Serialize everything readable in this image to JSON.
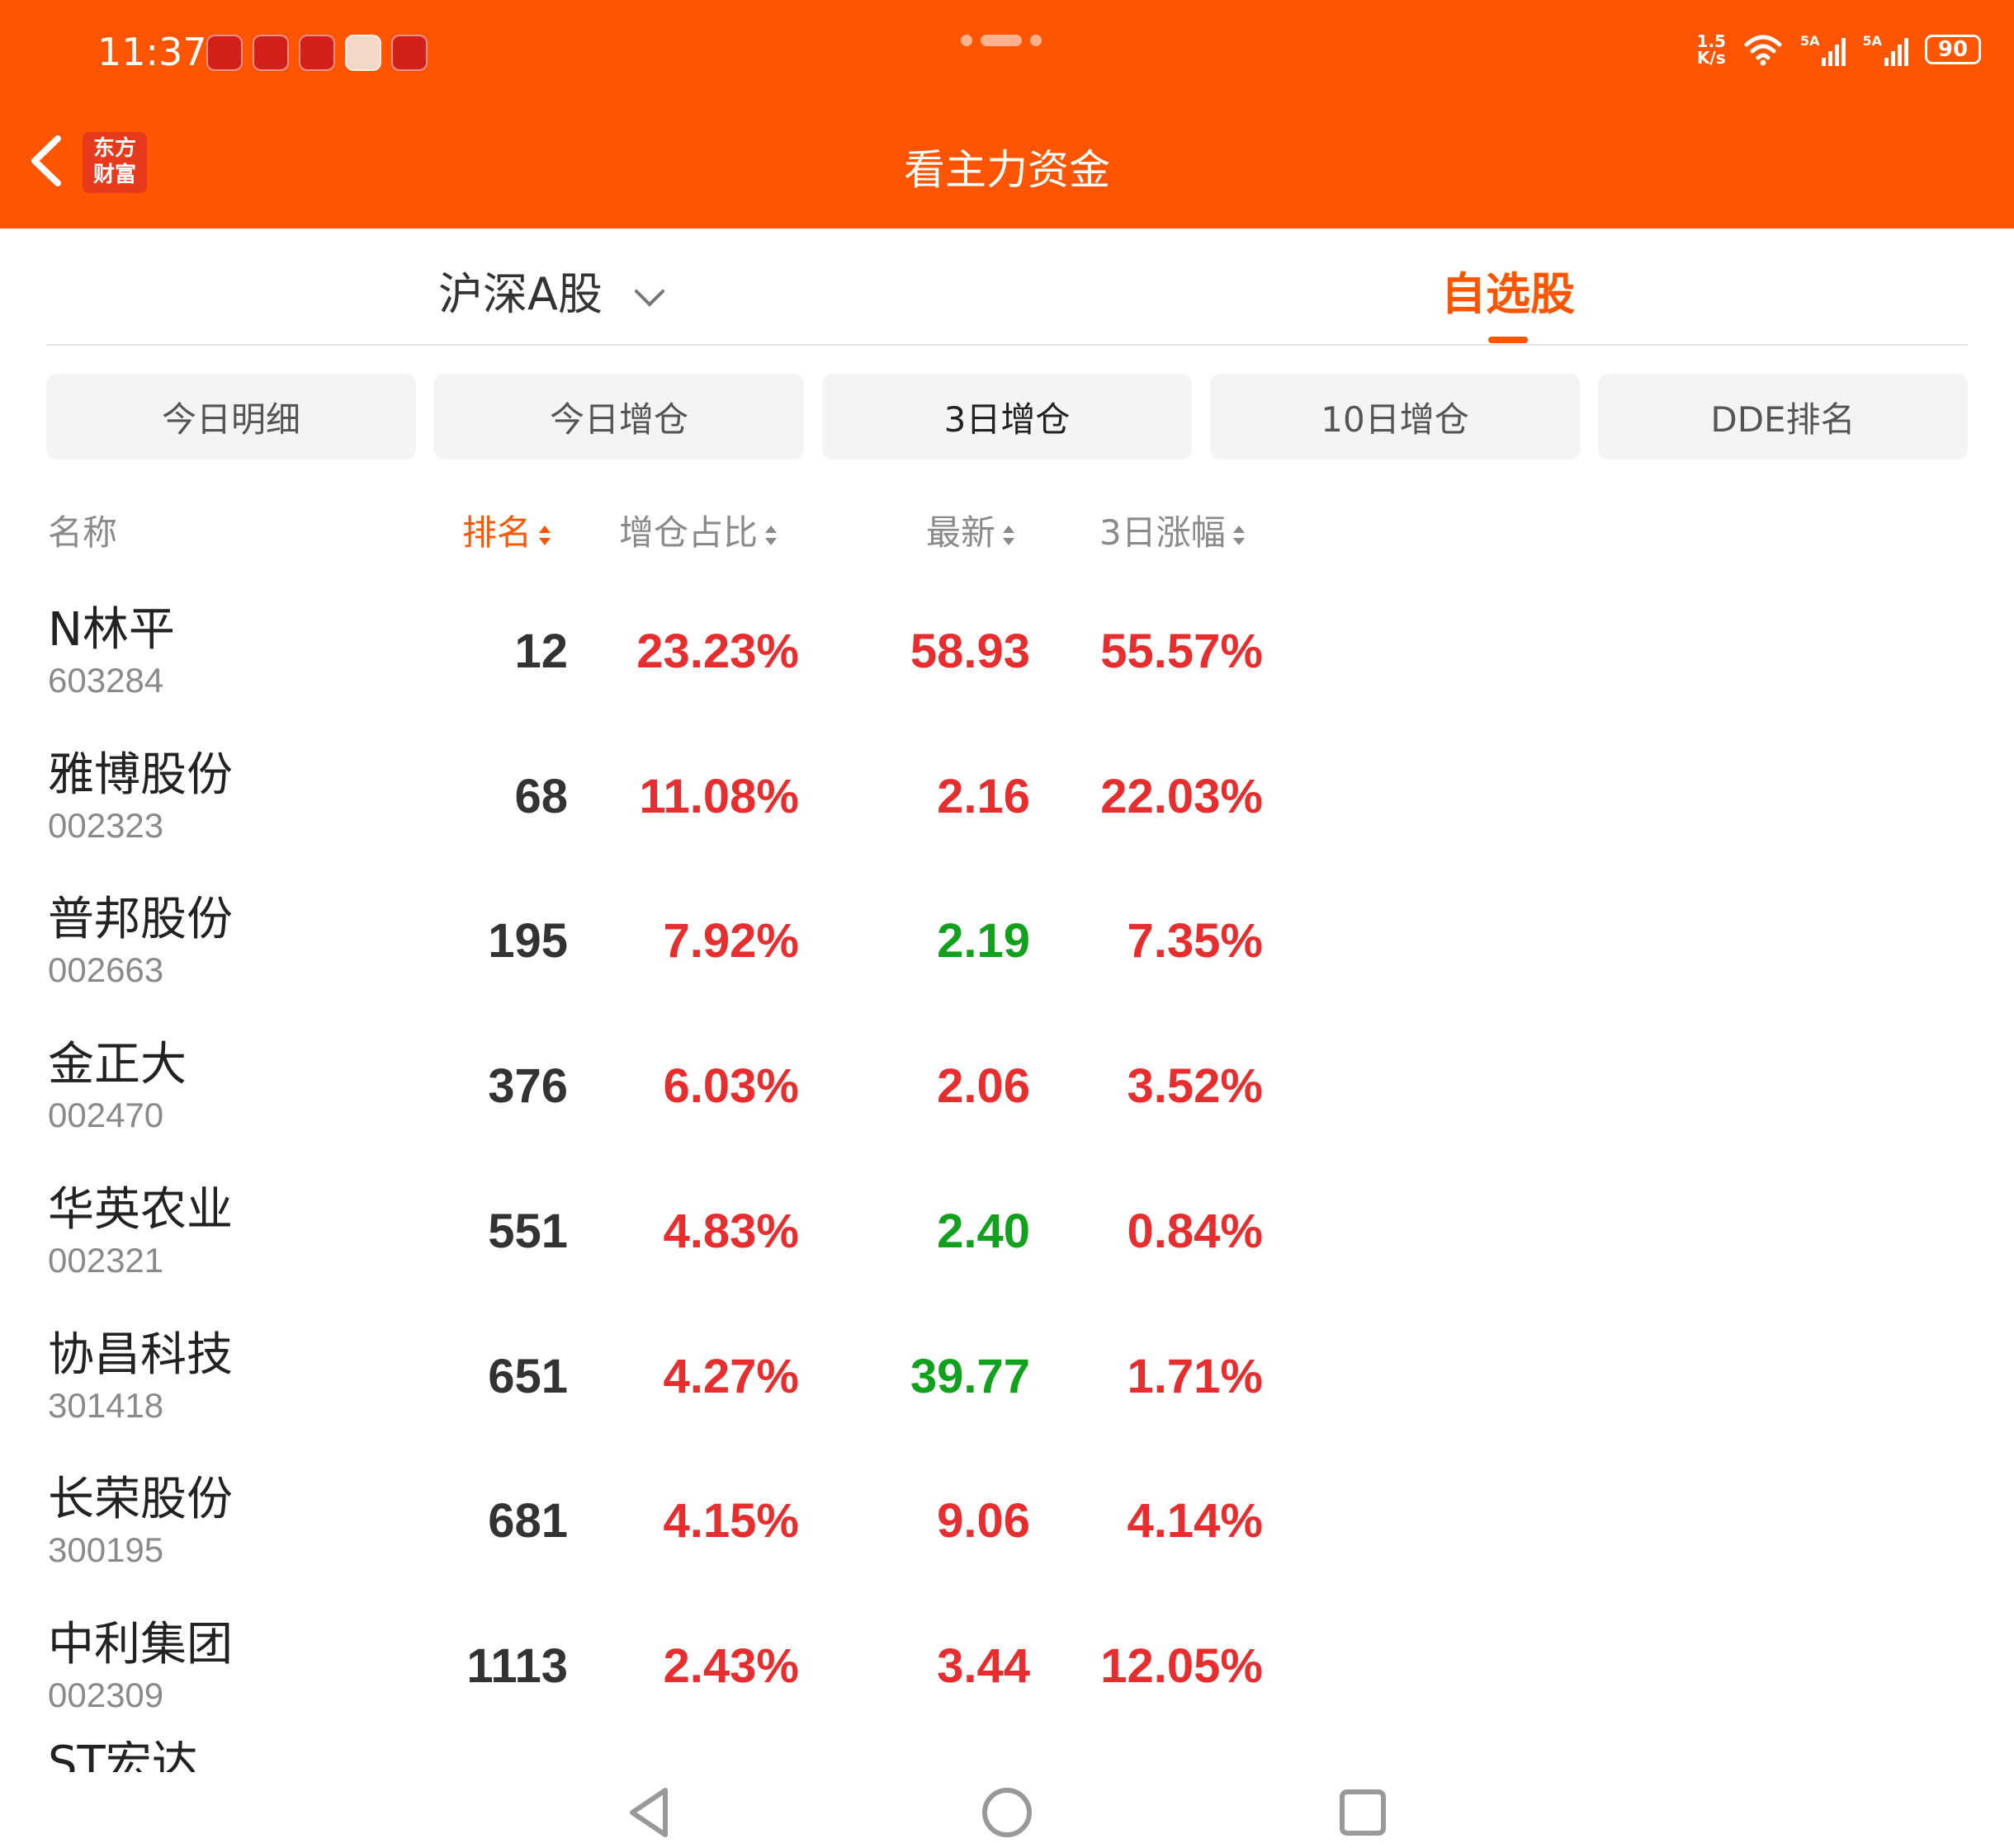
{
  "status_bar": {
    "time": "11:37",
    "net_speed_value": "1.5",
    "net_speed_unit": "K/s",
    "battery": "90",
    "signal_1": "5A",
    "signal_2": "5A"
  },
  "header": {
    "back_icon": "chevron-left-icon",
    "logo_line1": "东方",
    "logo_line2": "财富",
    "title": "看主力资金"
  },
  "market_tabs": {
    "tab_a": "沪深A股",
    "tab_b": "自选股"
  },
  "filters": [
    "今日明细",
    "今日增仓",
    "3日增仓",
    "10日增仓",
    "DDE排名"
  ],
  "columns": {
    "name": "名称",
    "rank": "排名",
    "ratio": "增仓占比",
    "latest": "最新",
    "change": "3日涨幅"
  },
  "rows": [
    {
      "name": "N林平",
      "code": "603284",
      "rank": "12",
      "ratio": "23.23%",
      "latest": "58.93",
      "latest_dir": "up",
      "change": "55.57%"
    },
    {
      "name": "雅博股份",
      "code": "002323",
      "rank": "68",
      "ratio": "11.08%",
      "latest": "2.16",
      "latest_dir": "up",
      "change": "22.03%"
    },
    {
      "name": "普邦股份",
      "code": "002663",
      "rank": "195",
      "ratio": "7.92%",
      "latest": "2.19",
      "latest_dir": "down",
      "change": "7.35%"
    },
    {
      "name": "金正大",
      "code": "002470",
      "rank": "376",
      "ratio": "6.03%",
      "latest": "2.06",
      "latest_dir": "up",
      "change": "3.52%"
    },
    {
      "name": "华英农业",
      "code": "002321",
      "rank": "551",
      "ratio": "4.83%",
      "latest": "2.40",
      "latest_dir": "down",
      "change": "0.84%"
    },
    {
      "name": "协昌科技",
      "code": "301418",
      "rank": "651",
      "ratio": "4.27%",
      "latest": "39.77",
      "latest_dir": "down",
      "change": "1.71%"
    },
    {
      "name": "长荣股份",
      "code": "300195",
      "rank": "681",
      "ratio": "4.15%",
      "latest": "9.06",
      "latest_dir": "up",
      "change": "4.14%"
    },
    {
      "name": "中利集团",
      "code": "002309",
      "rank": "1113",
      "ratio": "2.43%",
      "latest": "3.44",
      "latest_dir": "up",
      "change": "12.05%"
    }
  ],
  "partial_row_name": "ST宏达",
  "colors": {
    "accent": "#ff5500",
    "up": "#e72d2d",
    "down": "#12a11c"
  }
}
